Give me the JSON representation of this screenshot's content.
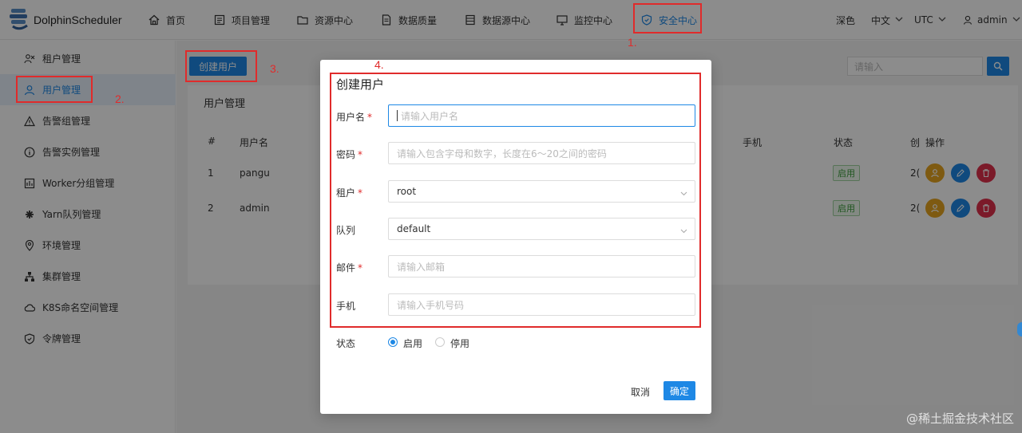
{
  "app": {
    "name": "DolphinScheduler"
  },
  "nav": [
    {
      "label": "首页",
      "icon": "home-icon"
    },
    {
      "label": "项目管理",
      "icon": "project-icon"
    },
    {
      "label": "资源中心",
      "icon": "folder-icon"
    },
    {
      "label": "数据质量",
      "icon": "document-icon"
    },
    {
      "label": "数据源中心",
      "icon": "database-icon"
    },
    {
      "label": "监控中心",
      "icon": "monitor-icon"
    },
    {
      "label": "安全中心",
      "icon": "shield-icon",
      "active": true
    }
  ],
  "header_tools": {
    "theme": "深色",
    "language": "中文",
    "timezone": "UTC",
    "user": "admin"
  },
  "sidebar": [
    {
      "label": "租户管理",
      "icon": "tenant-icon"
    },
    {
      "label": "用户管理",
      "icon": "user-icon",
      "active": true
    },
    {
      "label": "告警组管理",
      "icon": "alarm-icon"
    },
    {
      "label": "告警实例管理",
      "icon": "info-icon"
    },
    {
      "label": "Worker分组管理",
      "icon": "worker-icon"
    },
    {
      "label": "Yarn队列管理",
      "icon": "yarn-icon"
    },
    {
      "label": "环境管理",
      "icon": "location-icon"
    },
    {
      "label": "集群管理",
      "icon": "cluster-icon"
    },
    {
      "label": "K8S命名空间管理",
      "icon": "cloud-icon"
    },
    {
      "label": "令牌管理",
      "icon": "token-icon"
    }
  ],
  "main": {
    "create_button": "创建用户",
    "search_placeholder": "请输入",
    "section_title": "用户管理",
    "columns": {
      "index": "#",
      "username": "用户名",
      "phone": "手机",
      "status": "状态",
      "created_partial": "创",
      "actions": "操作"
    },
    "rows": [
      {
        "index": "1",
        "username": "pangu",
        "status": "启用",
        "created_partial": "2("
      },
      {
        "index": "2",
        "username": "admin",
        "status": "启用",
        "created_partial": "2("
      }
    ]
  },
  "modal": {
    "title": "创建用户",
    "fields": {
      "username": {
        "label": "用户名",
        "placeholder": "请输入用户名",
        "required": true
      },
      "password": {
        "label": "密码",
        "placeholder": "请输入包含字母和数字，长度在6～20之间的密码",
        "required": true
      },
      "tenant": {
        "label": "租户",
        "value": "root",
        "required": true
      },
      "queue": {
        "label": "队列",
        "value": "default",
        "required": false
      },
      "email": {
        "label": "邮件",
        "placeholder": "请输入邮箱",
        "required": true
      },
      "phone": {
        "label": "手机",
        "placeholder": "请输入手机号码",
        "required": false
      }
    },
    "status": {
      "label": "状态",
      "on": "启用",
      "off": "停用"
    },
    "cancel": "取消",
    "confirm": "确定"
  },
  "annotations": {
    "step1": "1.",
    "step2": "2.",
    "step3": "3.",
    "step4": "4.",
    "req_mark": "*"
  },
  "watermark": "@稀土掘金技术社区",
  "colors": {
    "accent": "#1e88e5",
    "highlight": "#e02b2b",
    "success": "#3a9c3a"
  }
}
